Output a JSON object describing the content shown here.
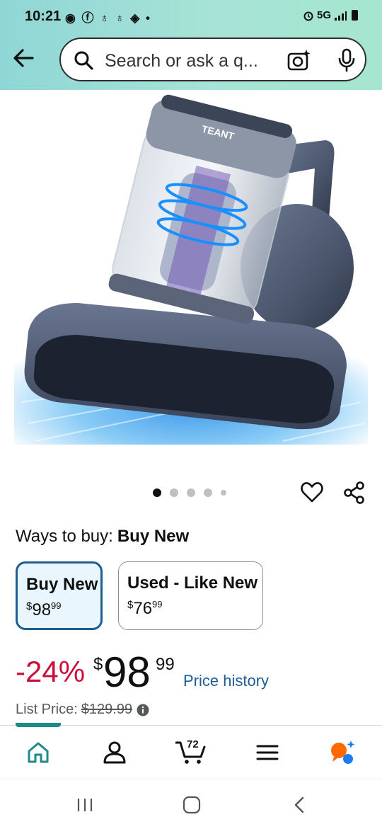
{
  "status_bar": {
    "time": "10:21",
    "left_icons": "◉ ⓕ ♁ ♁ ◈ •",
    "network": "5G",
    "signal_icon": "signal-icon",
    "battery_icon": "battery-icon"
  },
  "search": {
    "placeholder": "Search or ask a q..."
  },
  "product": {
    "image_label": "TEANT",
    "image_dots_count": 5,
    "active_dot_index": 0
  },
  "ways_to_buy": {
    "label": "Ways to buy:",
    "selected": "Buy New"
  },
  "options": [
    {
      "title": "Buy New",
      "currency": "$",
      "whole": "98",
      "fraction": "99",
      "selected": true
    },
    {
      "title": "Used - Like New",
      "currency": "$",
      "whole": "76",
      "fraction": "99",
      "selected": false
    }
  ],
  "pricing": {
    "discount": "-24%",
    "currency": "$",
    "whole": "98",
    "fraction": "99",
    "price_history_label": "Price history",
    "list_price_label": "List Price:",
    "list_price_value": "$129.99"
  },
  "bottom_nav": {
    "cart_count": "72",
    "items": [
      "home-icon",
      "account-icon",
      "cart-icon",
      "menu-icon",
      "rufus-icon"
    ]
  },
  "colors": {
    "header_gradient_start": "#8fd6d6",
    "header_gradient_end": "#a6e6cf",
    "discount_red": "#cc0c39",
    "link_blue": "#1e5c99",
    "selected_border": "#1f5e8f",
    "nav_teal": "#1f8a8a"
  }
}
